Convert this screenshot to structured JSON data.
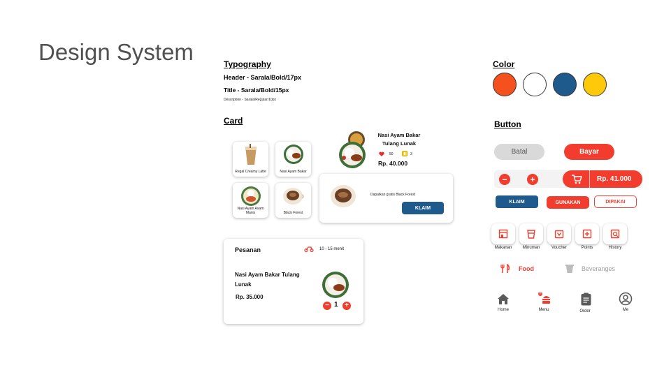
{
  "page_title": "Design System",
  "typography": {
    "heading": "Typography",
    "header_spec": "Header - Sarala/Bold/17px",
    "title_spec": "Title - Sarala/Bold/15px",
    "description_spec": "Description - Sarala/Regular/10px"
  },
  "color": {
    "heading": "Color",
    "swatches": [
      "#f4511e",
      "#ffffff",
      "#1e5a8c",
      "#fdc90a"
    ]
  },
  "card": {
    "heading": "Card",
    "small_cards": [
      {
        "label": "Regal Creamy Latte"
      },
      {
        "label": "Nasi Ayam Bakar"
      },
      {
        "label": "Nasi Ayam Asam Manis"
      },
      {
        "label": "Black Forest"
      }
    ],
    "product": {
      "name_line1": "Nasi Ayam Bakar",
      "name_line2": "Tulang Lunak",
      "likes": "50",
      "rating": "3",
      "price": "Rp. 40.000"
    },
    "voucher": {
      "text": "Dapatkan gratis Black Forest",
      "button": "KLAIM"
    },
    "order": {
      "title": "Pesanan",
      "delivery_time": "10 - 15 menit",
      "item_line1": "Nasi Ayam Bakar Tulang",
      "item_line2": "Lunak",
      "price": "Rp. 35.000",
      "quantity": "1",
      "minus": "−",
      "plus": "+"
    }
  },
  "button": {
    "heading": "Button",
    "cancel": "Batal",
    "pay": "Bayar",
    "minus": "−",
    "plus": "+",
    "cart_total": "Rp. 41.000",
    "claim": "KLAIM",
    "use": "GUNAKAN",
    "used": "DIPAKAI",
    "categories": [
      {
        "label": "Makanan",
        "icon": "store-icon"
      },
      {
        "label": "Minuman",
        "icon": "cup-icon"
      },
      {
        "label": "Voucher",
        "icon": "voucher-icon"
      },
      {
        "label": "Points",
        "icon": "points-icon"
      },
      {
        "label": "History",
        "icon": "history-icon"
      }
    ],
    "tab_food": "Food",
    "tab_beverages": "Beveranges",
    "bottom_nav": [
      {
        "label": "Home",
        "icon": "home-icon"
      },
      {
        "label": "Menu",
        "icon": "menu-icon"
      },
      {
        "label": "Order",
        "icon": "order-icon"
      },
      {
        "label": "Me",
        "icon": "profile-icon"
      }
    ]
  },
  "accent_colors": {
    "red": "#f23c2d",
    "blue": "#1e5a8c",
    "grey": "#d9d9d9"
  }
}
